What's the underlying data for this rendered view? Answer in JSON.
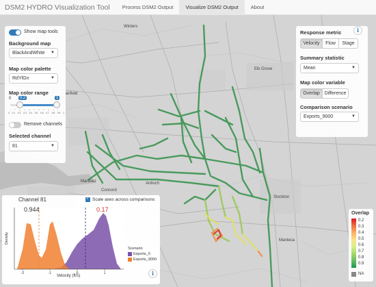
{
  "app": {
    "title": "DSM2 HYDRO Visualization Tool",
    "tabs": [
      {
        "label": "Process DSM2 Output",
        "active": false
      },
      {
        "label": "Visualize DSM2 Output",
        "active": true
      },
      {
        "label": "About",
        "active": false
      }
    ]
  },
  "left_panel": {
    "show_map_tools_label": "Show map tools",
    "show_map_tools_on": true,
    "background_map_label": "Background map",
    "background_map_value": "BlackAndWhite",
    "palette_label": "Map color palette",
    "palette_value": "RdYlGn",
    "color_range_label": "Map color range",
    "range_min_label": "0",
    "range_low": "0.2",
    "range_high": "1",
    "range_max_label": "1",
    "ticks": [
      "0",
      "0.1",
      "0.2",
      "0.3",
      "0.4",
      "0.5",
      "0.6",
      "0.7",
      "0.8",
      "0.9",
      "1"
    ],
    "remove_channels_label": "Remove channels",
    "remove_channels_on": false,
    "selected_channel_label": "Selected channel",
    "selected_channel_value": "81"
  },
  "right_panel": {
    "response_metric_label": "Response metric",
    "response_metric_options": [
      "Velocity",
      "Flow",
      "Stage"
    ],
    "response_metric_selected": "Velocity",
    "summary_statistic_label": "Summary statistic",
    "summary_statistic_value": "Mean",
    "map_color_variable_label": "Map color variable",
    "map_color_variable_options": [
      "Overlap",
      "Difference"
    ],
    "map_color_variable_selected": "Overlap",
    "comparison_scenario_label": "Comparison scenario",
    "comparison_scenario_value": "Exports_9000"
  },
  "map_labels": {
    "fairfield": "Fairfield",
    "elk_grove": "Elk Grove",
    "concord": "Concord",
    "antioch": "Antioch",
    "stockton": "Stockton",
    "manteca": "Manteca",
    "martinez": "Martinez"
  },
  "legend": {
    "title": "Overlap",
    "ticks": [
      "0.2",
      "0.3",
      "0.4",
      "0.5",
      "0.6",
      "0.7",
      "0.8",
      "0.9"
    ],
    "na_label": "NA"
  },
  "plot_panel": {
    "channel_title": "Channel 81",
    "scale_axes_label": "Scale axes across comparisons",
    "scale_axes_checked": true,
    "overlap_left": "0.944",
    "overlap_right": "0.17",
    "ylabel": "Density",
    "xlabel": "Velocity (ft/s)",
    "xticks": [
      "-2",
      "-1",
      "0",
      "1"
    ],
    "legend_title": "Scenario",
    "legend_items": [
      "Exports_0",
      "Exports_9000"
    ]
  },
  "colors": {
    "accent": "#337ab7",
    "exports_0": "#7a52a8",
    "exports_9000": "#f08030",
    "channel_green": "#2e8b3e"
  },
  "icons": {
    "info": "info-icon",
    "caret": "caret-down-icon",
    "checkbox": "checkbox-icon"
  },
  "chart_data": {
    "type": "area",
    "title": "Channel 81",
    "xlabel": "Velocity (ft/s)",
    "ylabel": "Density",
    "xlim": [
      -2.3,
      1.7
    ],
    "series": [
      {
        "name": "Exports_0",
        "x": [
          -0.9,
          -0.6,
          -0.4,
          -0.2,
          0.0,
          0.2,
          0.4,
          0.6,
          0.8,
          0.95,
          1.05,
          1.15,
          1.3,
          1.45,
          1.6
        ],
        "values": [
          0.0,
          0.03,
          0.12,
          0.3,
          0.45,
          0.55,
          0.62,
          0.7,
          0.9,
          1.0,
          0.95,
          0.78,
          0.4,
          0.1,
          0.0
        ]
      },
      {
        "name": "Exports_9000",
        "x": [
          -2.2,
          -2.0,
          -1.85,
          -1.7,
          -1.55,
          -1.4,
          -1.3,
          -1.15,
          -1.0,
          -0.9,
          -0.75,
          -0.6,
          -0.45,
          -0.3
        ],
        "values": [
          0.0,
          0.35,
          0.82,
          0.8,
          0.5,
          0.25,
          0.2,
          0.35,
          0.8,
          0.85,
          0.6,
          0.3,
          0.08,
          0.0
        ]
      }
    ],
    "vlines": [
      {
        "x": -1.4,
        "series": "Exports_9000"
      },
      {
        "x": 0.3,
        "series": "Exports_0"
      }
    ],
    "annotations": [
      "0.944",
      "0.17"
    ]
  }
}
